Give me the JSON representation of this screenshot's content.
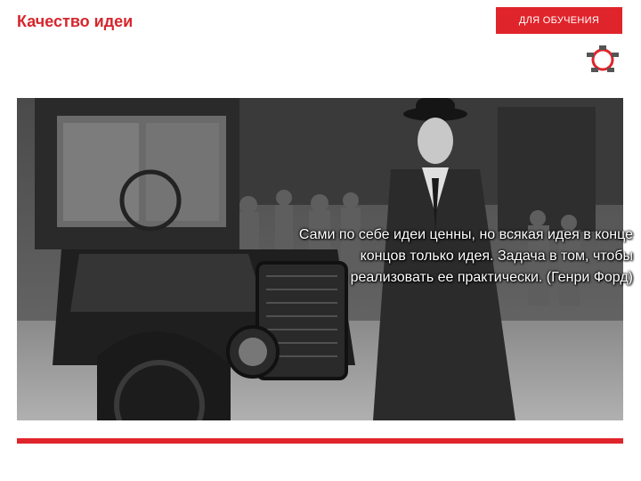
{
  "slide": {
    "title": "Качество идеи",
    "tag": "ДЛЯ ОБУЧЕНИЯ"
  },
  "photo": {
    "quote": "Сами по себе идеи ценны, но всякая идея в конце концов только идея. Задача в том, чтобы реализовать ее практически. (Генри Форд)"
  },
  "colors": {
    "accent": "#e0242b",
    "title": "#d6262c"
  },
  "icons": {
    "logo": "network-ring-icon"
  }
}
